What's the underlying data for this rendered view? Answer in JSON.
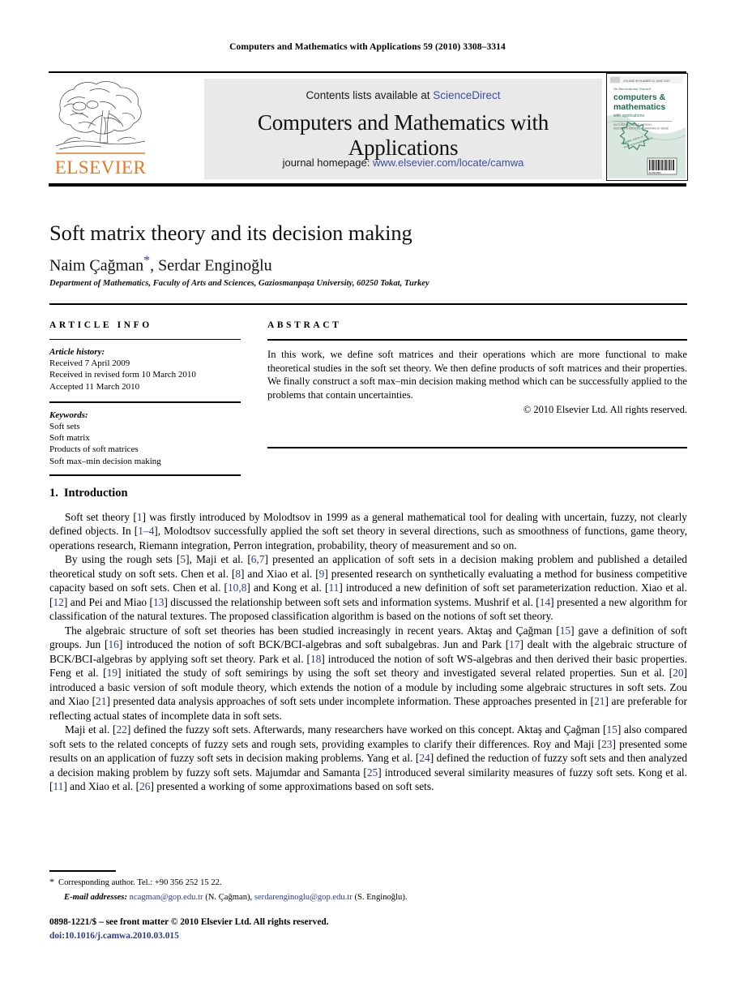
{
  "running_head": "Computers and Mathematics with Applications 59 (2010) 3308–3314",
  "masthead": {
    "publisher_name": "ELSEVIER",
    "contents_prefix": "Contents lists available at ",
    "contents_link": "ScienceDirect",
    "journal_title": "Computers and Mathematics with Applications",
    "homepage_prefix": "journal homepage: ",
    "homepage_link": "www.elsevier.com/locate/camwa",
    "cover": {
      "line1": "An International Journal",
      "line2": "computers &",
      "line3": "mathematics",
      "line4": "with applications",
      "badge": "available online"
    }
  },
  "article": {
    "title": "Soft matrix theory and its decision making",
    "authors": "Naim Çağman",
    "authors_rest": ", Serdar Enginoğlu",
    "corresponding_marker": "*",
    "affiliation": "Department of Mathematics, Faculty of Arts and Sciences, Gaziosmanpaşa University, 60250 Tokat, Turkey"
  },
  "info": {
    "heading": "ARTICLE INFO",
    "history_label": "Article history:",
    "history": [
      "Received 7 April 2009",
      "Received in revised form 10 March 2010",
      "Accepted 11 March 2010"
    ],
    "keywords_label": "Keywords:",
    "keywords": [
      "Soft sets",
      "Soft matrix",
      "Products of soft matrices",
      "Soft max–min decision making"
    ]
  },
  "abstract": {
    "heading": "ABSTRACT",
    "text": "In this work, we define soft matrices and their operations which are more functional to make theoretical studies in the soft set theory. We then define products of soft matrices and their properties. We finally construct a soft max–min decision making method which can be successfully applied to the problems that contain uncertainties.",
    "copyright": "© 2010 Elsevier Ltd. All rights reserved."
  },
  "section": {
    "number": "1.",
    "title": "Introduction"
  },
  "paragraphs": [
    {
      "id": "p1",
      "parts": [
        {
          "t": "Soft set theory ["
        },
        {
          "t": "1",
          "ref": true
        },
        {
          "t": "] was firstly introduced by Molodtsov in 1999 as a general mathematical tool for dealing with uncertain, fuzzy, not clearly defined objects. In ["
        },
        {
          "t": "1–4",
          "ref": true
        },
        {
          "t": "], Molodtsov successfully applied the soft set theory in several directions, such as smoothness of functions, game theory, operations research, Riemann integration, Perron integration, probability, theory of measurement and so on."
        }
      ]
    },
    {
      "id": "p2",
      "parts": [
        {
          "t": "By using the rough sets ["
        },
        {
          "t": "5",
          "ref": true
        },
        {
          "t": "], Maji et al. ["
        },
        {
          "t": "6,7",
          "ref": true
        },
        {
          "t": "] presented an application of soft sets in a decision making problem and published a detailed theoretical study on soft sets. Chen et al. ["
        },
        {
          "t": "8",
          "ref": true
        },
        {
          "t": "] and Xiao et al. ["
        },
        {
          "t": "9",
          "ref": true
        },
        {
          "t": "] presented research on synthetically evaluating a method for business competitive capacity based on soft sets. Chen et al. ["
        },
        {
          "t": "10,8",
          "ref": true
        },
        {
          "t": "] and Kong et al. ["
        },
        {
          "t": "11",
          "ref": true
        },
        {
          "t": "] introduced a new definition of soft set parameterization reduction. Xiao et al. ["
        },
        {
          "t": "12",
          "ref": true
        },
        {
          "t": "] and Pei and Miao ["
        },
        {
          "t": "13",
          "ref": true
        },
        {
          "t": "] discussed the relationship between soft sets and information systems. Mushrif et al. ["
        },
        {
          "t": "14",
          "ref": true
        },
        {
          "t": "] presented a new algorithm for classification of the natural textures. The proposed classification algorithm is based on the notions of soft set theory."
        }
      ]
    },
    {
      "id": "p3",
      "parts": [
        {
          "t": "The algebraic structure of soft set theories has been studied increasingly in recent years. Aktaş and Çağman ["
        },
        {
          "t": "15",
          "ref": true
        },
        {
          "t": "] gave a definition of soft groups. Jun ["
        },
        {
          "t": "16",
          "ref": true
        },
        {
          "t": "] introduced the notion of soft BCK/BCI-algebras and soft subalgebras. Jun and Park ["
        },
        {
          "t": "17",
          "ref": true
        },
        {
          "t": "] dealt with the algebraic structure of BCK/BCI-algebras by applying soft set theory. Park et al. ["
        },
        {
          "t": "18",
          "ref": true
        },
        {
          "t": "] introduced the notion of soft WS-algebras and then derived their basic properties. Feng et al. ["
        },
        {
          "t": "19",
          "ref": true
        },
        {
          "t": "] initiated the study of soft semirings by using the soft set theory and investigated several related properties. Sun et al. ["
        },
        {
          "t": "20",
          "ref": true
        },
        {
          "t": "] introduced a basic version of soft module theory, which extends the notion of a module by including some algebraic structures in soft sets. Zou and Xiao ["
        },
        {
          "t": "21",
          "ref": true
        },
        {
          "t": "] presented data analysis approaches of soft sets under incomplete information. These approaches presented in ["
        },
        {
          "t": "21",
          "ref": true
        },
        {
          "t": "] are preferable for reflecting actual states of incomplete data in soft sets."
        }
      ]
    },
    {
      "id": "p4",
      "parts": [
        {
          "t": "Maji et al. ["
        },
        {
          "t": "22",
          "ref": true
        },
        {
          "t": "] defined the fuzzy soft sets. Afterwards, many researchers have worked on this concept. Aktaş and Çağman ["
        },
        {
          "t": "15",
          "ref": true
        },
        {
          "t": "] also compared soft sets to the related concepts of fuzzy sets and rough sets, providing examples to clarify their differences. Roy and Maji ["
        },
        {
          "t": "23",
          "ref": true
        },
        {
          "t": "] presented some results on an application of fuzzy soft sets in decision making problems. Yang et al. ["
        },
        {
          "t": "24",
          "ref": true
        },
        {
          "t": "] defined the reduction of fuzzy soft sets and then analyzed a decision making problem by fuzzy soft sets. Majumdar and Samanta ["
        },
        {
          "t": "25",
          "ref": true
        },
        {
          "t": "] introduced several similarity measures of fuzzy soft sets. Kong et al. ["
        },
        {
          "t": "11",
          "ref": true
        },
        {
          "t": "] and Xiao et al. ["
        },
        {
          "t": "26",
          "ref": true
        },
        {
          "t": "] presented a working of some approximations based on soft sets."
        }
      ]
    }
  ],
  "footnote": {
    "marker": "*",
    "corresponding": "Corresponding author. Tel.: +90 356 252 15 22.",
    "email_label": "E-mail addresses:",
    "email1": "ncagman@gop.edu.tr",
    "email1_owner": " (N. Çağman), ",
    "email2": "serdarenginoglu@gop.edu.tr",
    "email2_owner": " (S. Enginoğlu)."
  },
  "footer": {
    "issn_line": "0898-1221/$ – see front matter © 2010 Elsevier Ltd. All rights reserved.",
    "doi": "doi:10.1016/j.camwa.2010.03.015"
  },
  "colors": {
    "link_blue": "#3a4fa0",
    "ref_blue": "#2a3b8f",
    "elsevier_orange": "#e87722",
    "masthead_gray": "#e9e9e9"
  }
}
